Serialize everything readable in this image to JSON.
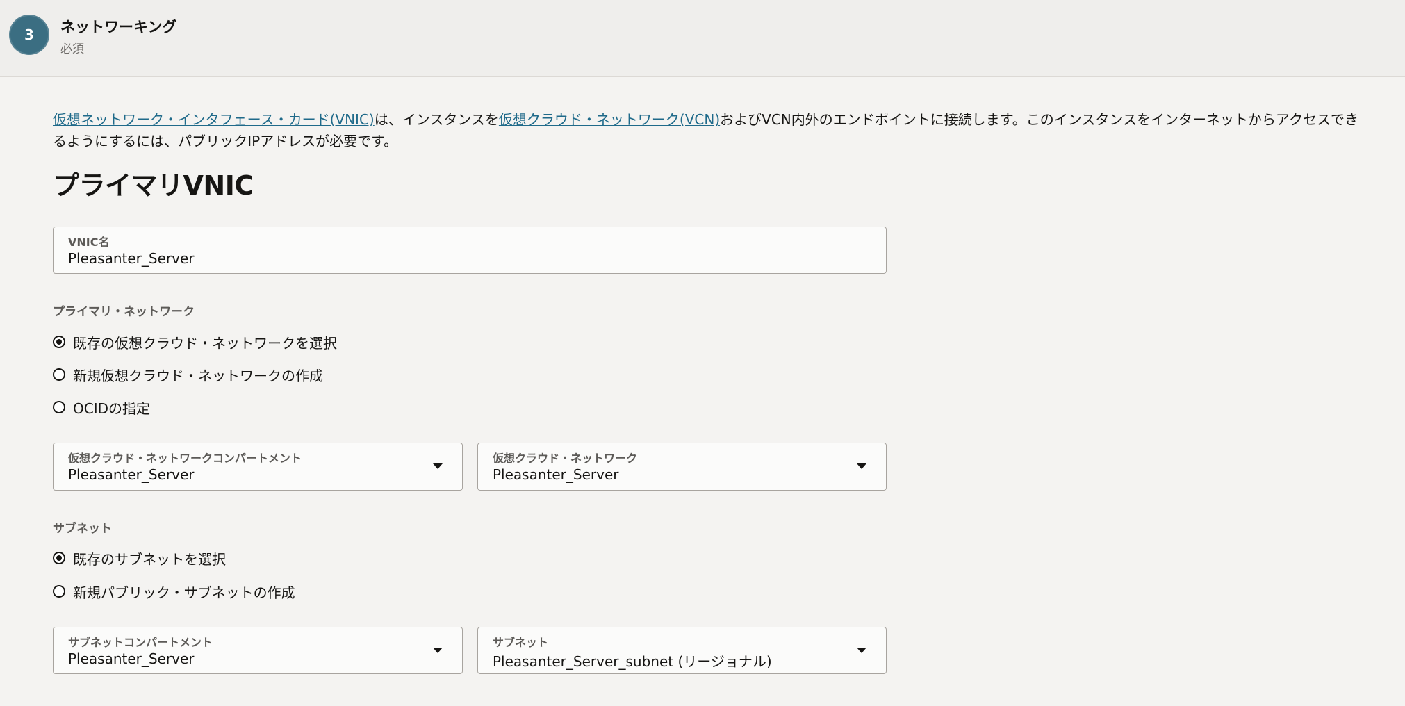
{
  "header": {
    "step_number": "3",
    "title": "ネットワーキング",
    "subtitle": "必須"
  },
  "intro": {
    "link1": "仮想ネットワーク・インタフェース・カード(VNIC)",
    "text1": "は、インスタンスを",
    "link2": "仮想クラウド・ネットワーク(VCN)",
    "text2": "およびVCN内外のエンドポイントに接続します。このインスタンスをインターネットからアクセスできるようにするには、パブリックIPアドレスが必要です。"
  },
  "section": {
    "title": "プライマリVNIC"
  },
  "vnic_name": {
    "label": "VNIC名",
    "value": "Pleasanter_Server"
  },
  "primary_network": {
    "label": "プライマリ・ネットワーク",
    "options": [
      {
        "label": "既存の仮想クラウド・ネットワークを選択",
        "selected": true
      },
      {
        "label": "新規仮想クラウド・ネットワークの作成",
        "selected": false
      },
      {
        "label": "OCIDの指定",
        "selected": false
      }
    ]
  },
  "vcn_compartment": {
    "label": "仮想クラウド・ネットワークコンパートメント",
    "value": "Pleasanter_Server"
  },
  "vcn": {
    "label": "仮想クラウド・ネットワーク",
    "value": "Pleasanter_Server"
  },
  "subnet_section": {
    "label": "サブネット",
    "options": [
      {
        "label": "既存のサブネットを選択",
        "selected": true
      },
      {
        "label": "新規パブリック・サブネットの作成",
        "selected": false
      }
    ]
  },
  "subnet_compartment": {
    "label": "サブネットコンパートメント",
    "value": "Pleasanter_Server"
  },
  "subnet": {
    "label": "サブネット",
    "value": "Pleasanter_Server_subnet (リージョナル)"
  }
}
